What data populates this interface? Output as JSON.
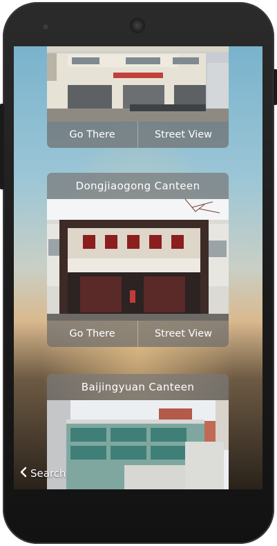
{
  "cards": [
    {
      "title": "",
      "go_there": "Go There",
      "street_view": "Street View"
    },
    {
      "title": "Dongjiaogong Canteen",
      "go_there": "Go There",
      "street_view": "Street View",
      "sign_text": "东教工食堂"
    },
    {
      "title": "Baijingyuan Canteen"
    }
  ],
  "nav": {
    "back_label": "Search",
    "back_icon": "chevron-left-icon"
  },
  "colors": {
    "overlay_gray": "#7a7a7a",
    "label_white": "#ffffff"
  }
}
